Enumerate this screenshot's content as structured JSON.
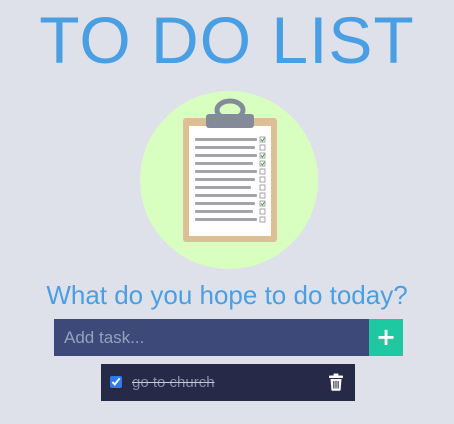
{
  "header": {
    "title": "TO DO LIST"
  },
  "hero": {
    "icon": "clipboard-checklist-icon",
    "circle_color": "#d8ffc0"
  },
  "prompt": {
    "text": "What do you hope to do today?"
  },
  "add_task": {
    "placeholder": "Add task...",
    "value": "",
    "button_label": "+"
  },
  "tasks": [
    {
      "text": "go to church",
      "completed": true,
      "delete_icon": "trash-icon"
    }
  ],
  "colors": {
    "background": "#dfe1ea",
    "accent_blue": "#4a9fe3",
    "input_bg": "#3d4979",
    "add_button_bg": "#1ec9a1",
    "task_bg": "#262a48"
  }
}
